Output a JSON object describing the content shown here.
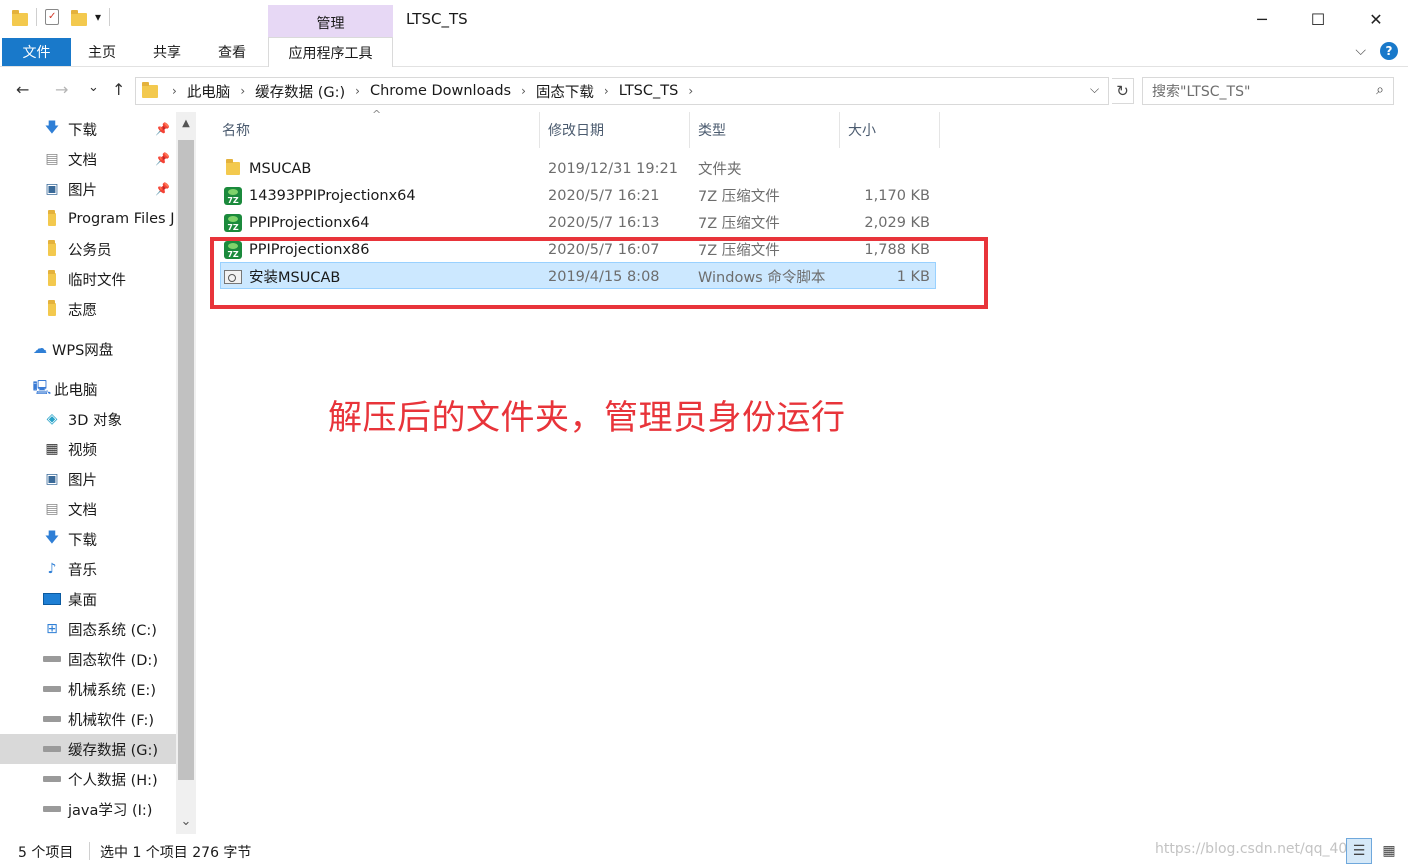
{
  "window": {
    "title": "LTSC_TS",
    "context_group": "管理",
    "minimize": "─",
    "maximize": "☐",
    "close": "✕"
  },
  "quick_access": {
    "dropdown": "▾"
  },
  "ribbon": {
    "tabs": [
      "文件",
      "主页",
      "共享",
      "查看",
      "应用程序工具"
    ],
    "expand": "⌵",
    "help": "?"
  },
  "address": {
    "back": "←",
    "forward": "→",
    "recent": "⌄",
    "up": "↑",
    "crumbs": [
      "此电脑",
      "缓存数据 (G:)",
      "Chrome Downloads",
      "固态下载",
      "LTSC_TS"
    ],
    "separator": "›",
    "dropdown": "⌵",
    "refresh": "↻",
    "search_placeholder": "搜索\"LTSC_TS\"",
    "search_icon": "⌕"
  },
  "nav": {
    "quick": [
      {
        "label": "下载",
        "icon": "download-icon",
        "pinned": true
      },
      {
        "label": "文档",
        "icon": "document-icon",
        "pinned": true
      },
      {
        "label": "图片",
        "icon": "picture-icon",
        "pinned": true
      },
      {
        "label": "Program Files J",
        "icon": "folder-icon",
        "pinned": false
      },
      {
        "label": "公务员",
        "icon": "folder-icon",
        "pinned": false
      },
      {
        "label": "临时文件",
        "icon": "folder-icon",
        "pinned": false
      },
      {
        "label": "志愿",
        "icon": "folder-icon",
        "pinned": false
      }
    ],
    "wps": "WPS网盘",
    "pc": "此电脑",
    "pc_items": [
      {
        "label": "3D 对象",
        "icon": "3d-objects-icon"
      },
      {
        "label": "视频",
        "icon": "video-icon"
      },
      {
        "label": "图片",
        "icon": "picture-icon"
      },
      {
        "label": "文档",
        "icon": "document-icon"
      },
      {
        "label": "下载",
        "icon": "download-icon"
      },
      {
        "label": "音乐",
        "icon": "music-icon"
      },
      {
        "label": "桌面",
        "icon": "desktop-icon"
      },
      {
        "label": "固态系统 (C:)",
        "icon": "windows-drive-icon"
      },
      {
        "label": "固态软件 (D:)",
        "icon": "drive-icon"
      },
      {
        "label": "机械系统 (E:)",
        "icon": "drive-icon"
      },
      {
        "label": "机械软件 (F:)",
        "icon": "drive-icon"
      },
      {
        "label": "缓存数据 (G:)",
        "icon": "drive-icon",
        "selected": true
      },
      {
        "label": "个人数据 (H:)",
        "icon": "drive-icon"
      },
      {
        "label": "java学习 (I:)",
        "icon": "drive-icon"
      }
    ],
    "pin_glyph": "📌",
    "scroll_up": "▲",
    "scroll_down": "⌄"
  },
  "columns": {
    "name": "名称",
    "date": "修改日期",
    "type": "类型",
    "size": "大小",
    "sort_caret": "^"
  },
  "files": [
    {
      "name": "MSUCAB",
      "date": "2019/12/31 19:21",
      "type": "文件夹",
      "size": "",
      "icon": "folder-icon"
    },
    {
      "name": "14393PPIProjectionx64",
      "date": "2020/5/7 16:21",
      "type": "7Z 压缩文件",
      "size": "1,170 KB",
      "icon": "7z-archive-icon"
    },
    {
      "name": "PPIProjectionx64",
      "date": "2020/5/7 16:13",
      "type": "7Z 压缩文件",
      "size": "2,029 KB",
      "icon": "7z-archive-icon"
    },
    {
      "name": "PPIProjectionx86",
      "date": "2020/5/7 16:07",
      "type": "7Z 压缩文件",
      "size": "1,788 KB",
      "icon": "7z-archive-icon"
    },
    {
      "name": "安装MSUCAB",
      "date": "2019/4/15 8:08",
      "type": "Windows 命令脚本",
      "size": "1 KB",
      "icon": "cmd-script-icon",
      "selected": true
    }
  ],
  "zip_label": "7Z",
  "annotation": "解压后的文件夹，管理员身份运行",
  "status": {
    "count": "5 个项目",
    "selection": "选中 1 个项目  276 字节",
    "watermark": "https://blog.csdn.net/qq_40",
    "details_view": "☰",
    "tiles_view": "▦"
  }
}
